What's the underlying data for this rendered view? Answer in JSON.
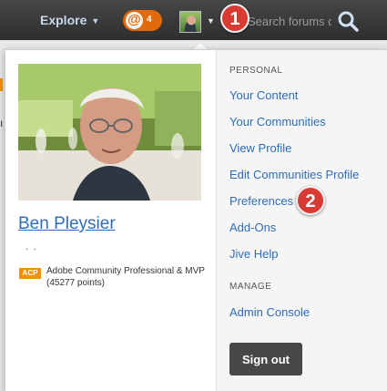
{
  "topbar": {
    "explore_label": "Explore",
    "mention_count": "4",
    "search_placeholder": "Search forums only",
    "step_badge_1": "1"
  },
  "profile": {
    "name": "Ben Pleysier",
    "badge_label": "ACP",
    "badge_description": "Adobe Community Professional & MVP (45277 points)"
  },
  "menu": {
    "personal_heading": "PERSONAL",
    "personal_items": [
      "Your Content",
      "Your Communities",
      "View Profile",
      "Edit Communities Profile",
      "Preferences",
      "Add-Ons",
      "Jive Help"
    ],
    "manage_heading": "MANAGE",
    "manage_items": [
      "Admin Console"
    ],
    "signout_label": "Sign out",
    "step_badge_2": "2"
  },
  "colors": {
    "topbar": "#3a3a3a",
    "link": "#2f6db5",
    "mention": "#e06a0c",
    "step_badge": "#d93a34",
    "acp_badge": "#f29200",
    "signout": "#484848"
  }
}
